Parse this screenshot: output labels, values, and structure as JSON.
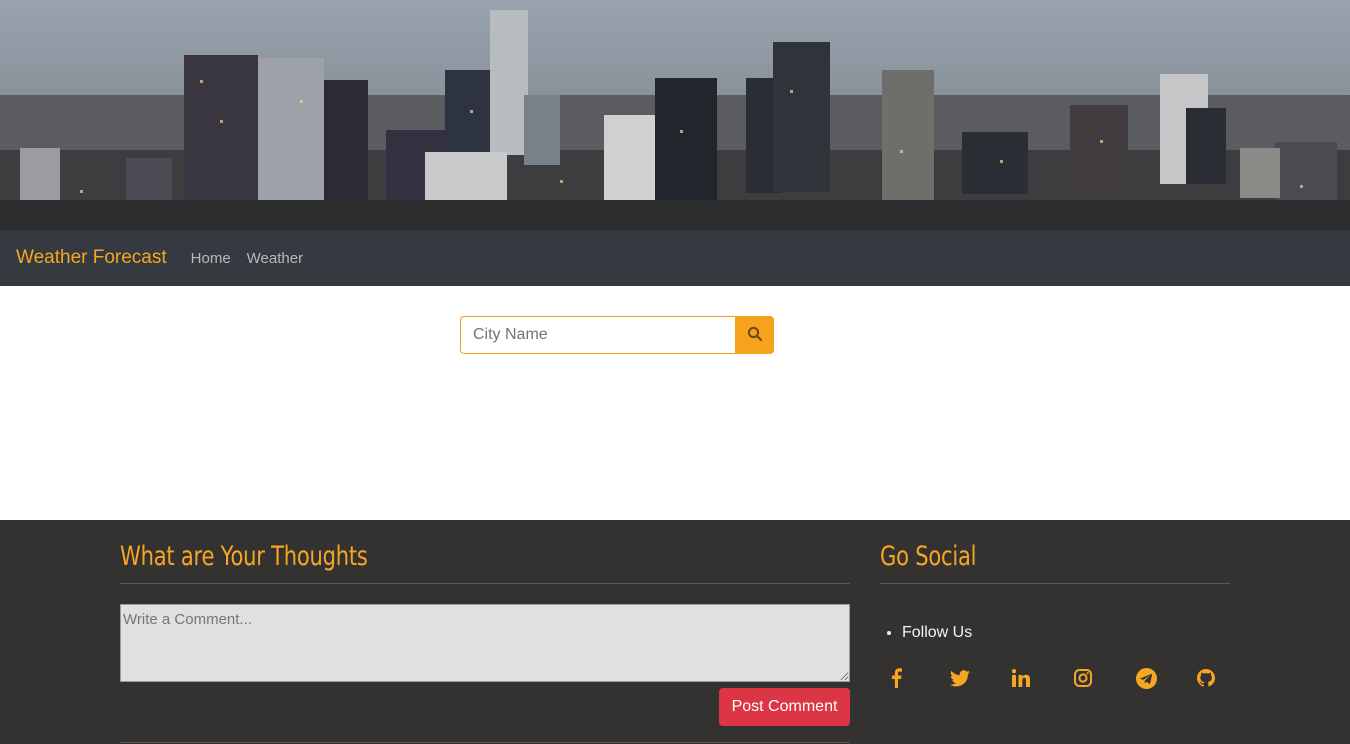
{
  "navbar": {
    "brand": "Weather Forecast",
    "links": [
      "Home",
      "Weather"
    ]
  },
  "search": {
    "placeholder": "City Name",
    "button_icon": "search-icon"
  },
  "footer": {
    "thoughts": {
      "heading": "What are Your Thoughts",
      "comment_placeholder": "Write a Comment...",
      "post_label": "Post Comment"
    },
    "social": {
      "heading": "Go Social",
      "follow_label": "Follow Us",
      "icons": [
        "facebook-icon",
        "twitter-icon",
        "linkedin-icon",
        "instagram-icon",
        "telegram-icon",
        "github-icon"
      ]
    }
  },
  "colors": {
    "accent": "#f5a623",
    "navbar_bg": "#343a40",
    "footer_bg": "#343231",
    "post_button": "#dc3545"
  }
}
